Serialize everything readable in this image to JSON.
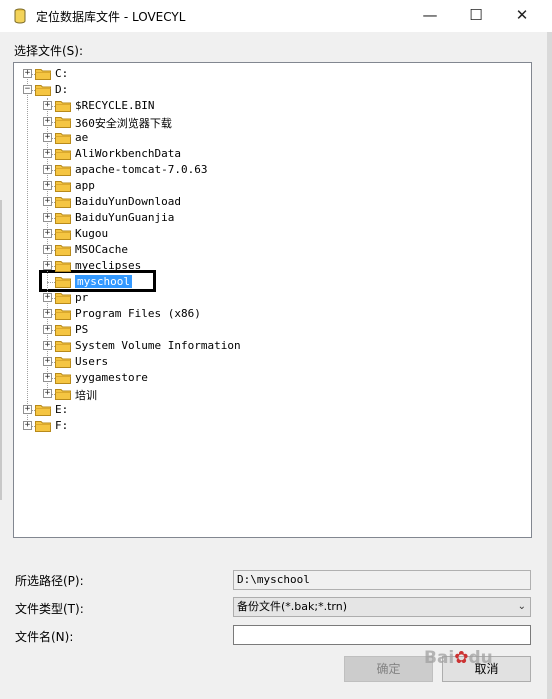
{
  "window": {
    "title": "定位数据库文件 - LOVECYL",
    "icon": "database-icon"
  },
  "tree": {
    "label": "选择文件(S):",
    "nodes": [
      {
        "label": "C:",
        "level": 0,
        "expanded": false
      },
      {
        "label": "D:",
        "level": 0,
        "expanded": true
      },
      {
        "label": "$RECYCLE.BIN",
        "level": 1
      },
      {
        "label": "360安全浏览器下载",
        "level": 1
      },
      {
        "label": "ae",
        "level": 1
      },
      {
        "label": "AliWorkbenchData",
        "level": 1
      },
      {
        "label": "apache-tomcat-7.0.63",
        "level": 1
      },
      {
        "label": "app",
        "level": 1
      },
      {
        "label": "BaiduYunDownload",
        "level": 1
      },
      {
        "label": "BaiduYunGuanjia",
        "level": 1
      },
      {
        "label": "Kugou",
        "level": 1
      },
      {
        "label": "MSOCache",
        "level": 1
      },
      {
        "label": "myeclipses",
        "level": 1
      },
      {
        "label": "myschool",
        "level": 1,
        "selected": true
      },
      {
        "label": "pr",
        "level": 1
      },
      {
        "label": "Program Files (x86)",
        "level": 1
      },
      {
        "label": "PS",
        "level": 1
      },
      {
        "label": "System Volume Information",
        "level": 1
      },
      {
        "label": "Users",
        "level": 1
      },
      {
        "label": "yygamestore",
        "level": 1
      },
      {
        "label": "培训",
        "level": 1
      },
      {
        "label": "E:",
        "level": 0,
        "expanded": false
      },
      {
        "label": "F:",
        "level": 0,
        "expanded": false
      }
    ]
  },
  "fields": {
    "path_label": "所选路径(P):",
    "path_value": "D:\\myschool",
    "type_label": "文件类型(T):",
    "type_value": "备份文件(*.bak;*.trn)",
    "name_label": "文件名(N):",
    "name_value": ""
  },
  "buttons": {
    "ok": "确定",
    "cancel": "取消"
  },
  "watermark": "Bai du",
  "colors": {
    "selection": "#3399ff",
    "folder": "#f5c542"
  }
}
